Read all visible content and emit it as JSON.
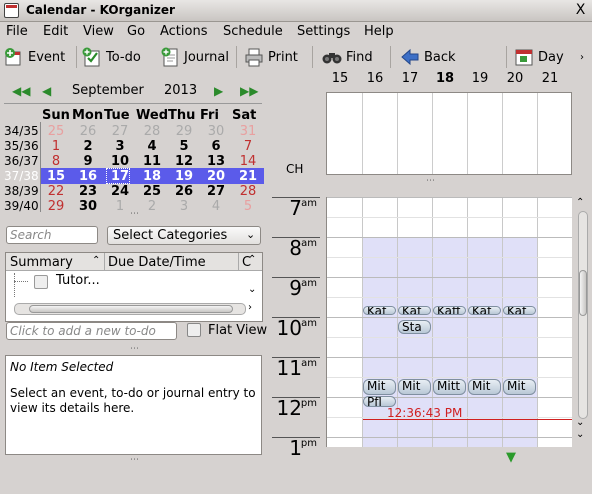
{
  "window": {
    "title": "Calendar - KOrganizer",
    "close_glyph": "X"
  },
  "menu": [
    "File",
    "Edit",
    "View",
    "Go",
    "Actions",
    "Schedule",
    "Settings",
    "Help"
  ],
  "toolbar": {
    "event": "Event",
    "todo": "To-do",
    "journal": "Journal",
    "print": "Print",
    "find": "Find",
    "back": "Back",
    "day": "Day"
  },
  "navigator": {
    "month": "September",
    "year": "2013",
    "weekday_headers": [
      "Sun",
      "Mon",
      "Tue",
      "Wed",
      "Thu",
      "Fri",
      "Sat"
    ],
    "weeks": [
      {
        "wk": "34/35",
        "days": [
          "25",
          "26",
          "27",
          "28",
          "29",
          "30",
          "31"
        ]
      },
      {
        "wk": "35/36",
        "days": [
          "1",
          "2",
          "3",
          "4",
          "5",
          "6",
          "7"
        ]
      },
      {
        "wk": "36/37",
        "days": [
          "8",
          "9",
          "10",
          "11",
          "12",
          "13",
          "14"
        ]
      },
      {
        "wk": "37/38",
        "days": [
          "15",
          "16",
          "17",
          "18",
          "19",
          "20",
          "21"
        ]
      },
      {
        "wk": "38/39",
        "days": [
          "22",
          "23",
          "24",
          "25",
          "26",
          "27",
          "28"
        ]
      },
      {
        "wk": "39/40",
        "days": [
          "29",
          "30",
          "1",
          "2",
          "3",
          "4",
          "5"
        ]
      }
    ]
  },
  "search": {
    "placeholder": "Search",
    "categories": "Select Categories"
  },
  "todo": {
    "col_summary": "Summary",
    "col_due": "Due Date/Time",
    "col_c": "C",
    "item": "Tutor...",
    "quick_add_placeholder": "Click to add a new to-do",
    "flat_view": "Flat View"
  },
  "details": {
    "title": "No Item Selected",
    "body": "Select an event, to-do or journal entry to view its details here."
  },
  "agenda": {
    "day_headers": [
      "15",
      "16",
      "17",
      "18",
      "19",
      "20",
      "21"
    ],
    "timezone": "CH",
    "hours": [
      {
        "n": "7",
        "s": "am"
      },
      {
        "n": "8",
        "s": "am"
      },
      {
        "n": "9",
        "s": "am"
      },
      {
        "n": "10",
        "s": "am"
      },
      {
        "n": "11",
        "s": "am"
      },
      {
        "n": "12",
        "s": "pm"
      },
      {
        "n": "1",
        "s": "pm"
      }
    ],
    "events_kaf": [
      "Kaf",
      "Kaf",
      "Kaff",
      "Kaf",
      "Kaf"
    ],
    "event_sta": "Sta",
    "events_mit": [
      "Mit",
      "Mit",
      "Mitt",
      "Mit",
      "Mit"
    ],
    "event_pfl": "Pfl",
    "current_time": "12:36:43 PM"
  },
  "colors": {
    "selection": "#5b5bea",
    "work_hours": "#e0e0f8",
    "time_marker": "#d02020"
  }
}
